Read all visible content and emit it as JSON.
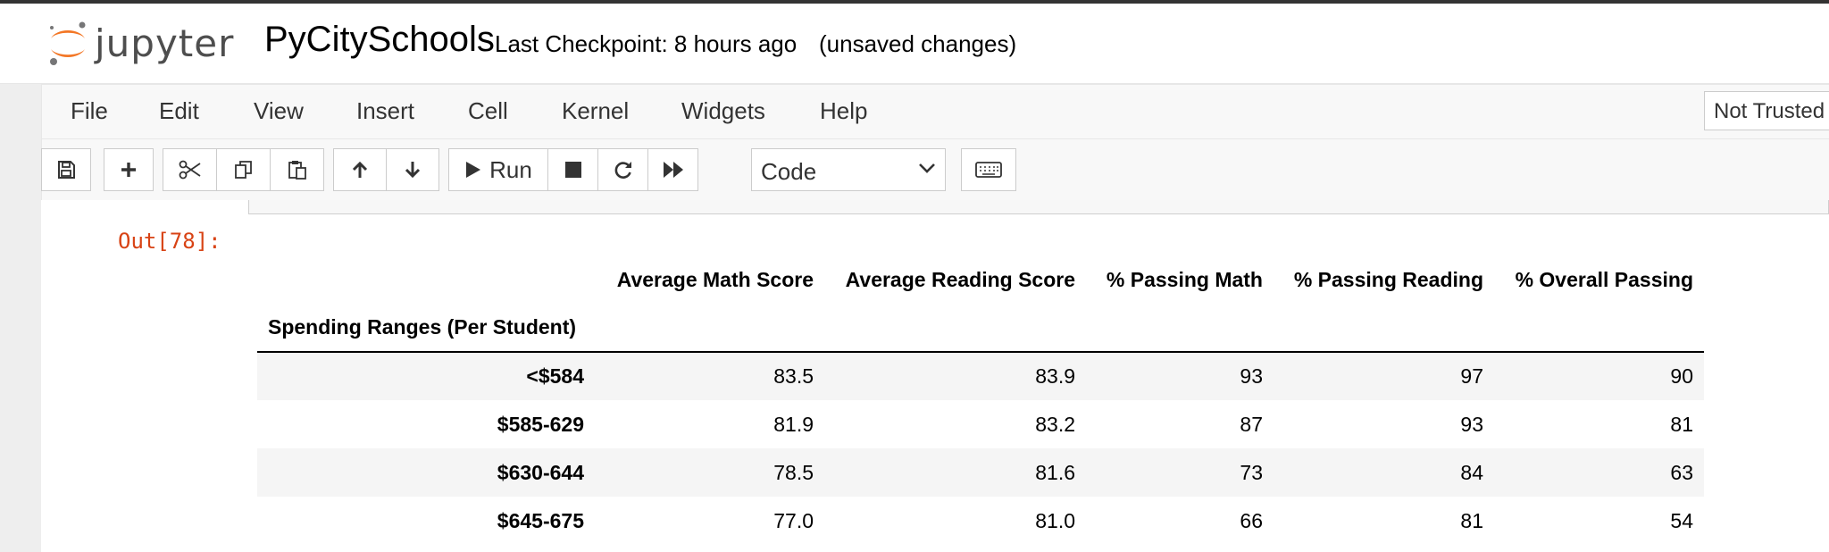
{
  "header": {
    "logo_text": "jupyter",
    "notebook_name": "PyCitySchools",
    "checkpoint": "Last Checkpoint: 8 hours ago",
    "unsaved": "(unsaved changes)"
  },
  "menu": {
    "items": [
      "File",
      "Edit",
      "View",
      "Insert",
      "Cell",
      "Kernel",
      "Widgets",
      "Help"
    ],
    "trust": "Not Trusted"
  },
  "toolbar": {
    "run_label": "Run",
    "cell_type": "Code"
  },
  "output": {
    "prompt": "Out[78]:",
    "index_name": "Spending Ranges (Per Student)",
    "columns": [
      "Average Math Score",
      "Average Reading Score",
      "% Passing Math",
      "% Passing Reading",
      "% Overall Passing"
    ],
    "rows": [
      {
        "index": "<$584",
        "values": [
          "83.5",
          "83.9",
          "93",
          "97",
          "90"
        ]
      },
      {
        "index": "$585-629",
        "values": [
          "81.9",
          "83.2",
          "87",
          "93",
          "81"
        ]
      },
      {
        "index": "$630-644",
        "values": [
          "78.5",
          "81.6",
          "73",
          "84",
          "63"
        ]
      },
      {
        "index": "$645-675",
        "values": [
          "77.0",
          "81.0",
          "66",
          "81",
          "54"
        ]
      }
    ]
  },
  "colors": {
    "prompt_out": "#d84315",
    "logo_orange": "#f37726",
    "logo_gray": "#767677"
  }
}
